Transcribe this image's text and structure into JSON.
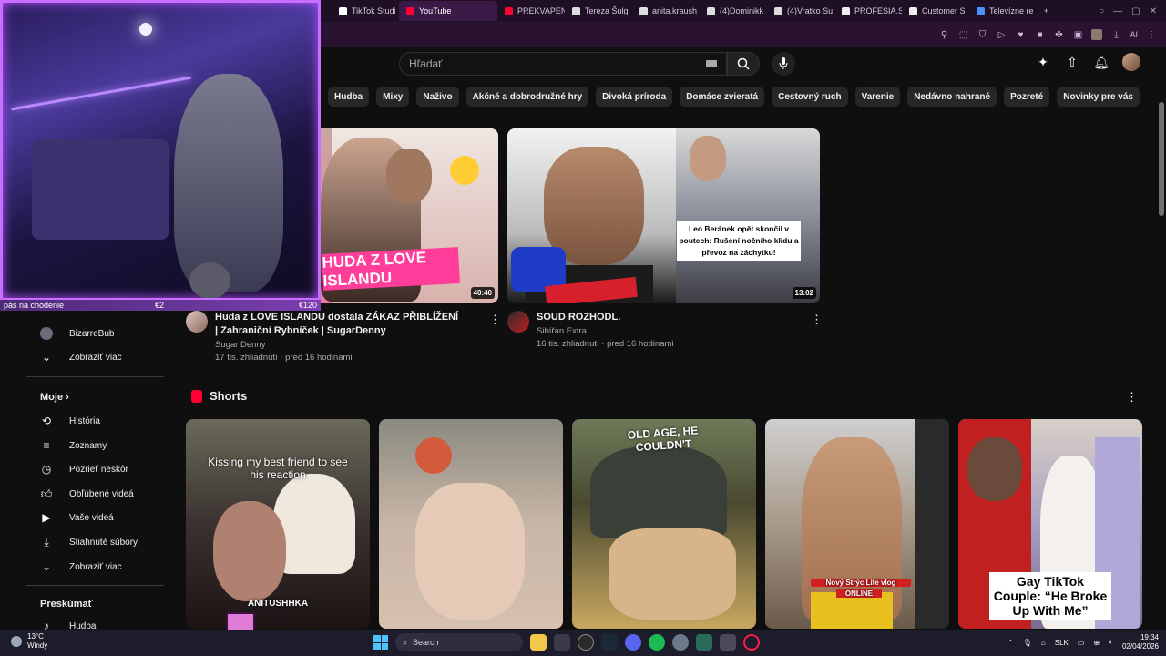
{
  "browser": {
    "tabs": [
      {
        "label": "TikTok Studi",
        "color": "#ffffff"
      },
      {
        "label": "YouTube",
        "color": "#ff0033",
        "active": true
      },
      {
        "label": "PREKVAPEN",
        "color": "#ff0033"
      },
      {
        "label": "Tereza Šulg",
        "color": "#ffffff"
      },
      {
        "label": "anita.kraush",
        "color": "#ffffff"
      },
      {
        "label": "(4)Dominikk",
        "color": "#ffffff"
      },
      {
        "label": "(4)Vratko Su",
        "color": "#ffffff"
      },
      {
        "label": "PROFESIA.S",
        "color": "#ffffff"
      },
      {
        "label": "Customer S",
        "color": "#ffffff"
      },
      {
        "label": "Televízne re",
        "color": "#4a90ff"
      }
    ],
    "new_tab_label": "+",
    "toolbar_ai_label": "AI"
  },
  "youtube": {
    "search_placeholder": "Hľadať",
    "chips": [
      "Hudba",
      "Mixy",
      "Naživo",
      "Akčné a dobrodružné hry",
      "Divoká príroda",
      "Domáce zvieratá",
      "Cestovný ruch",
      "Varenie",
      "Nedávno nahrané",
      "Pozreté",
      "Novinky pre vás"
    ]
  },
  "webcam": {
    "donation_left": "pás na chodenie",
    "donation_mid": "€2",
    "donation_right": "€120"
  },
  "sidebar": {
    "sub_bizarre": "BizarreBub",
    "show_more_1": "Zobraziť viac",
    "moje": "Moje",
    "historia": "História",
    "zoznamy": "Zoznamy",
    "pozriet_neskor": "Pozrieť neskôr",
    "oblubene": "Obľúbené videá",
    "vase_videa": "Vaše videá",
    "stiahnute": "Stiahnuté súbory",
    "show_more_2": "Zobraziť viac",
    "preskumat": "Preskúmať",
    "hudba": "Hudba"
  },
  "videos": [
    {
      "overlay_text": "HUDA Z LOVE ISLANDU",
      "duration": "40:40",
      "title": "Huda z LOVE ISLANDU dostala ZÁKAZ PŘIBLÍŽENÍ | Zahraniční Rybníček | SugarDenny",
      "channel": "Sugar Denny",
      "stats": "17 tis. zhliadnutí · pred 16 hodinami"
    },
    {
      "overlay_text": "Leo Beránek opět skončil v poutech: Rušení nočního klidu a převoz na záchytku!",
      "duration": "13:02",
      "title": "SOUD ROZHODL.",
      "channel": "Sibířan Extra",
      "stats": "16 tis. zhliadnutí · pred 16 hodinami"
    }
  ],
  "shorts": {
    "title": "Shorts",
    "items": [
      {
        "caption": "Kissing my best friend to see his reaction",
        "caption2": "ANITUSHHKA"
      },
      {
        "caption": ""
      },
      {
        "caption": "OLD AGE, HE COULDN'T"
      },
      {
        "caption": "Nový Strýc Life vlog",
        "caption2": "ONLINE"
      },
      {
        "caption": "Gay TikTok Couple: “He Broke Up With Me”"
      }
    ]
  },
  "taskbar": {
    "temp": "13°C",
    "weather": "Windy",
    "search": "Search",
    "lang": "SLK",
    "time": "19:34",
    "date": "02/04/2026"
  }
}
